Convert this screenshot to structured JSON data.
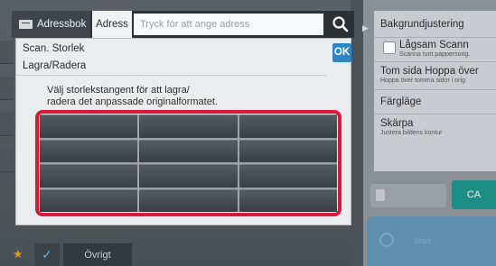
{
  "topbar": {
    "addressbook_label": "Adressbok",
    "address_label": "Adress",
    "address_placeholder": "Tryck för att ange adress",
    "search_icon": "search-icon"
  },
  "dialog": {
    "title": "Scan. Storlek",
    "subtitle": "Lagra/Radera",
    "ok_label": "OK",
    "instruction_line1": "Välj storlekstangent för att lagra/",
    "instruction_line2": "radera det anpassade originalformatet.",
    "keys": [
      "",
      "",
      "",
      "",
      "",
      "",
      "",
      "",
      "",
      "",
      "",
      ""
    ]
  },
  "settings": {
    "items": [
      {
        "title": "Bakgrundjustering",
        "sub": ""
      },
      {
        "title": "Lågsam Scann",
        "sub": "Scanna tunt pappersorig."
      },
      {
        "title": "Tom sida Hoppa över",
        "sub": "Hoppa över tomma sidor i orig."
      },
      {
        "title": "Färgläge",
        "sub": ""
      },
      {
        "title": "Skärpa",
        "sub": "Justera bildens kontur"
      }
    ]
  },
  "actions": {
    "ca_label": "CA",
    "start_label": "Start"
  },
  "bottom": {
    "other_label": "Övrigt"
  },
  "colors": {
    "highlight": "#d8193a",
    "ok": "#2b86c6",
    "ca": "#1d8e85"
  }
}
